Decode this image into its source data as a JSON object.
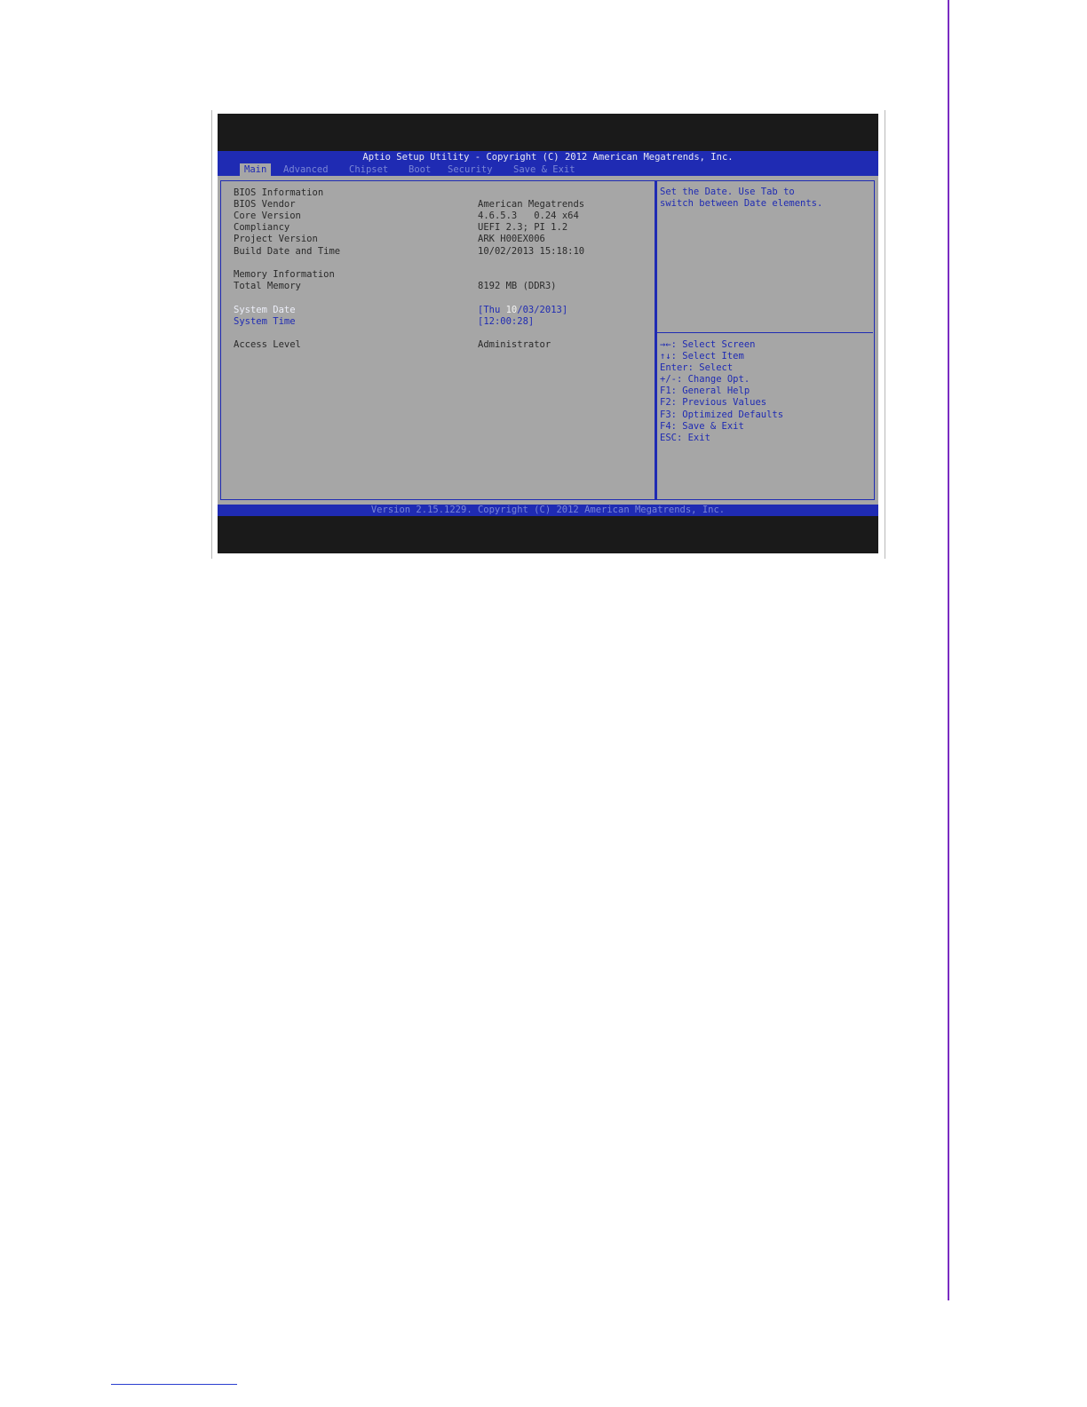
{
  "bios": {
    "title": "Aptio Setup Utility - Copyright (C) 2012 American Megatrends, Inc.",
    "tabs": [
      "Main",
      "Advanced",
      "Chipset",
      "Boot",
      "Security",
      "Save & Exit"
    ],
    "active_tab": "Main",
    "rows": {
      "bios_information": "BIOS Information",
      "bios_vendor_label": "BIOS Vendor",
      "bios_vendor_value": "American Megatrends",
      "core_version_label": "Core Version",
      "core_version_value": "4.6.5.3   0.24 x64",
      "compliancy_label": "Compliancy",
      "compliancy_value": "UEFI 2.3; PI 1.2",
      "project_version_label": "Project Version",
      "project_version_value": "ARK H00EX006",
      "build_date_label": "Build Date and Time",
      "build_date_value": "10/02/2013 15:18:10",
      "memory_information": "Memory Information",
      "total_memory_label": "Total Memory",
      "total_memory_value": "8192 MB (DDR3)",
      "system_date_label": "System Date",
      "system_date_prefix": "[Thu ",
      "system_date_month": "10",
      "system_date_suffix": "/03/2013]",
      "system_time_label": "System Time",
      "system_time_value": "[12:00:28]",
      "access_level_label": "Access Level",
      "access_level_value": "Administrator"
    },
    "help": {
      "line1": "Set the Date. Use Tab to",
      "line2": "switch between Date elements."
    },
    "keys": [
      "→←: Select Screen",
      "↑↓: Select Item",
      "Enter: Select",
      "+/-: Change Opt.",
      "F1: General Help",
      "F2: Previous Values",
      "F3: Optimized Defaults",
      "F4: Save & Exit",
      "ESC: Exit"
    ],
    "version": "Version 2.15.1229. Copyright (C) 2012 American Megatrends, Inc."
  },
  "colors": {
    "bios_blue": "#1f2bb3",
    "panel_gray": "#a6a6a6",
    "dim_text": "#7a86d6",
    "page_rule": "#7a2cc2"
  }
}
